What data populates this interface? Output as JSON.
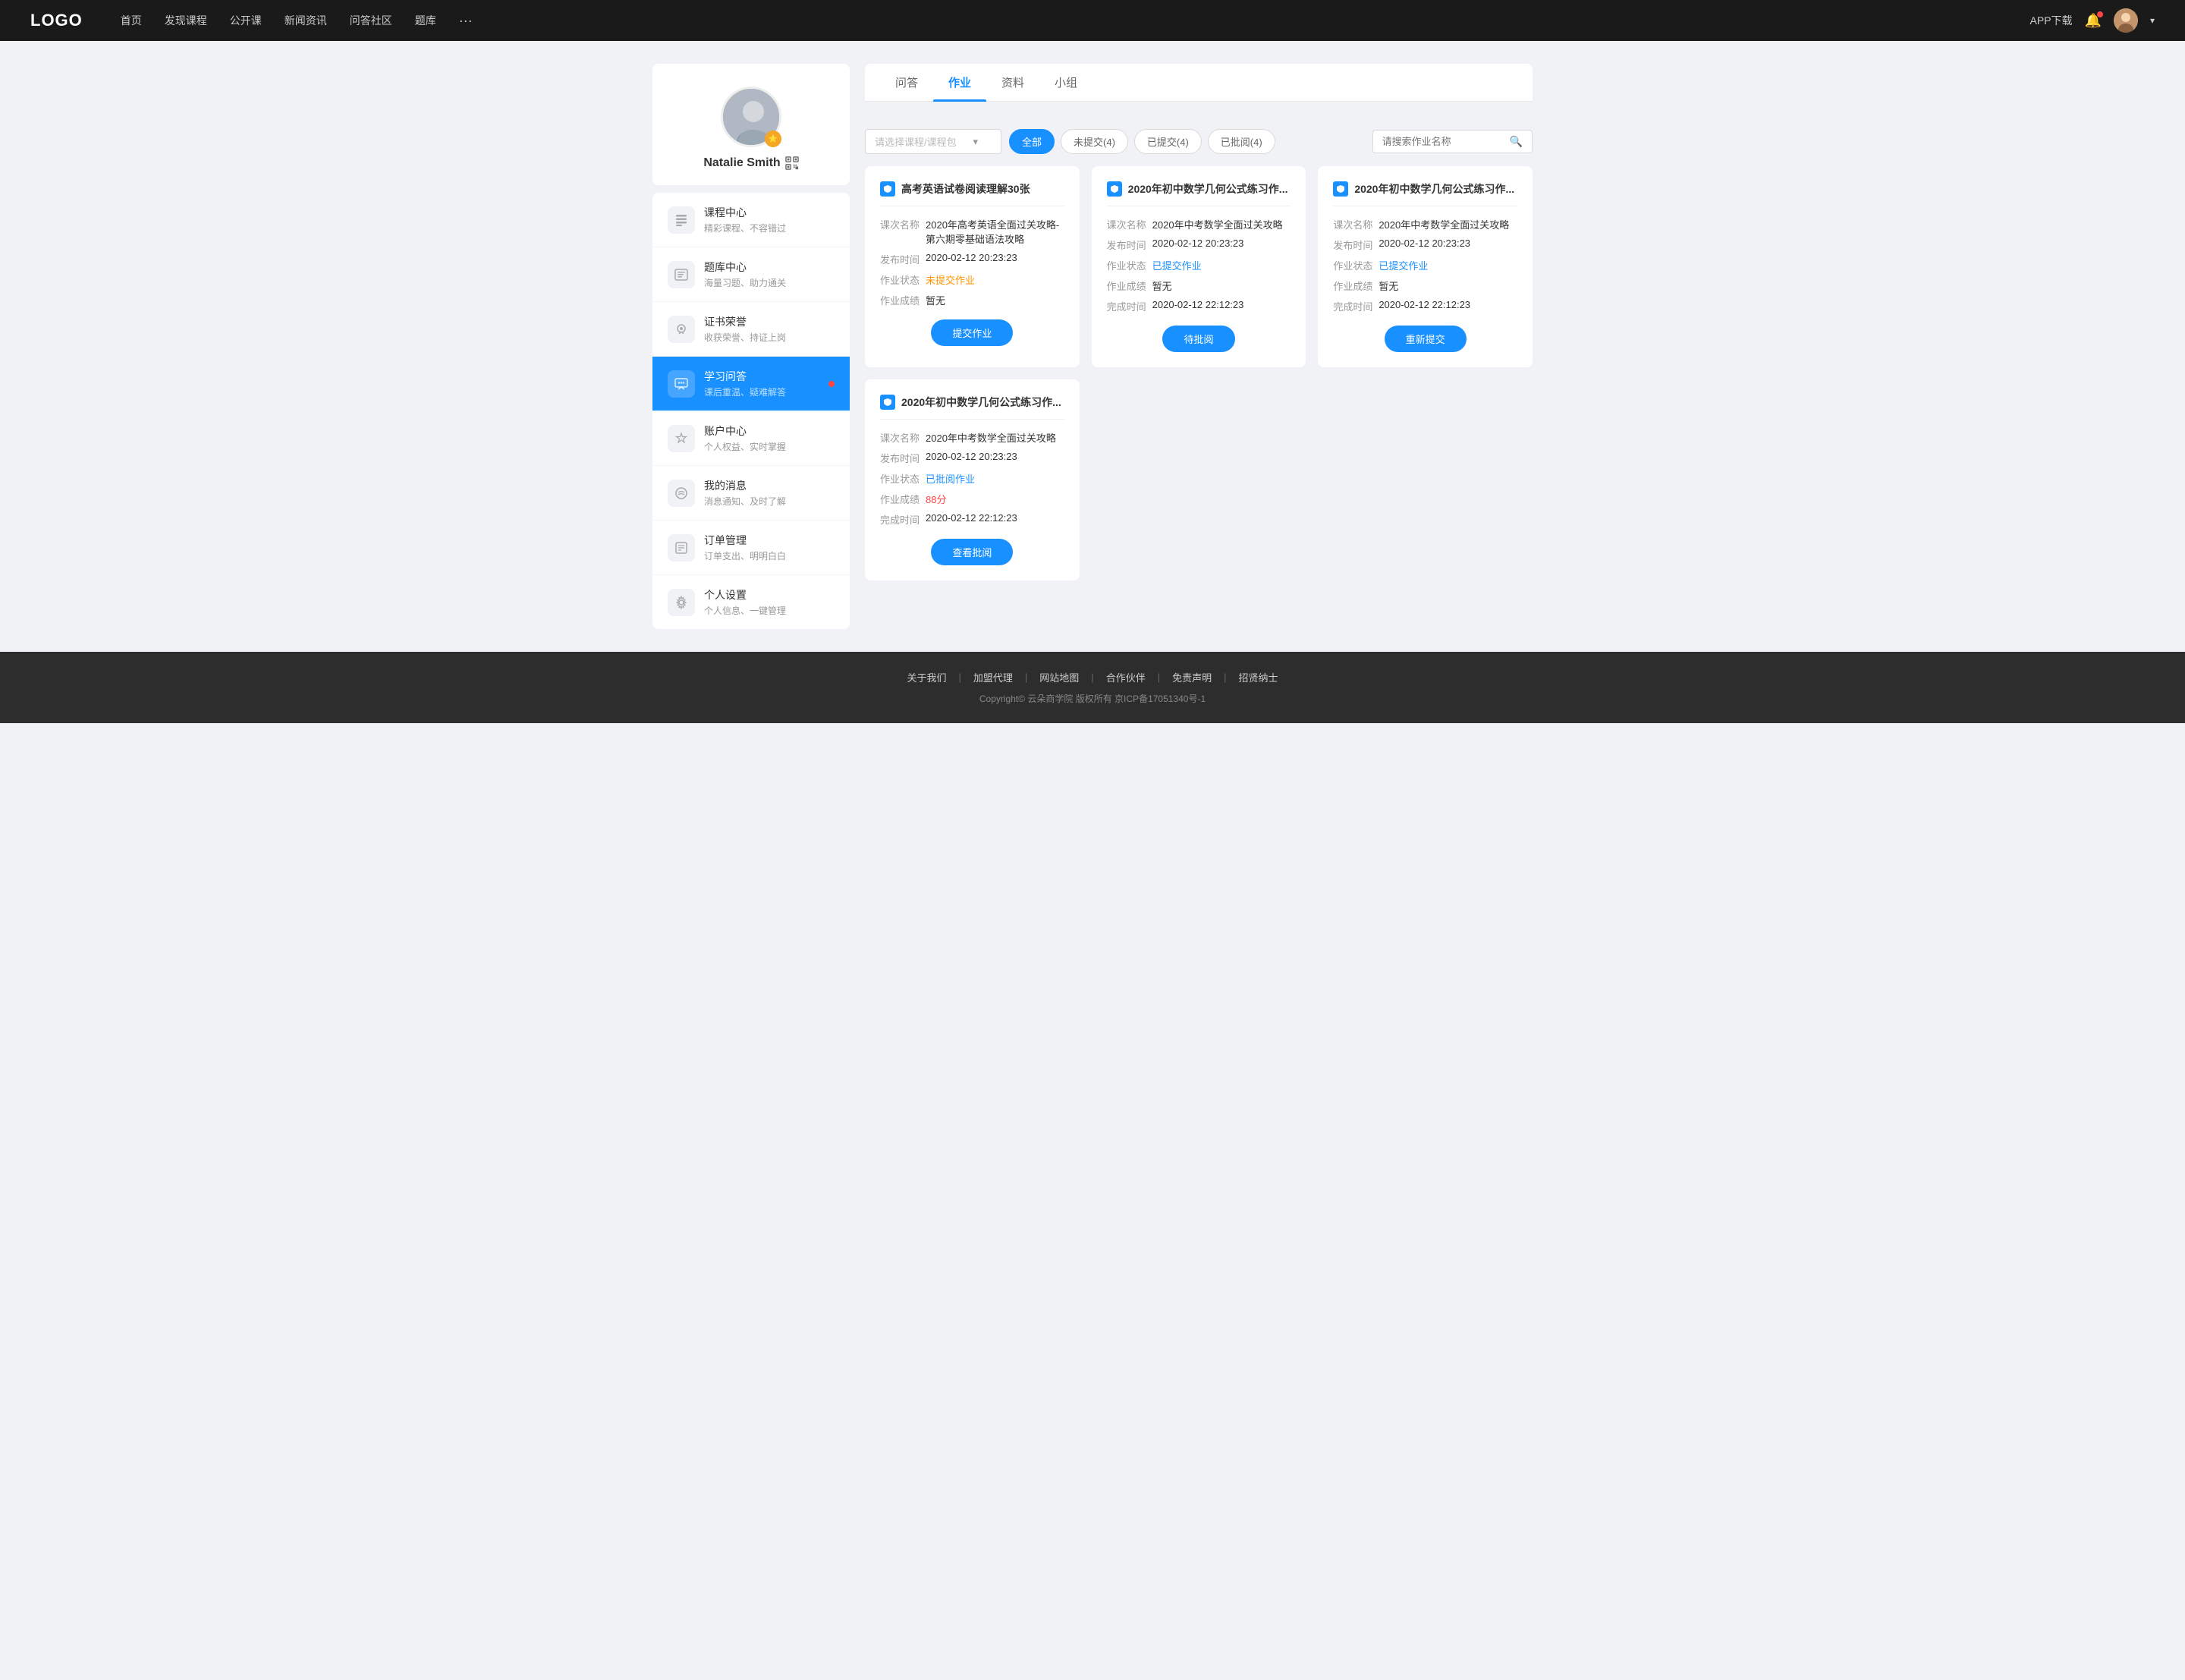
{
  "nav": {
    "logo": "LOGO",
    "items": [
      "首页",
      "发现课程",
      "公开课",
      "新闻资讯",
      "问答社区",
      "题库"
    ],
    "more": "···",
    "download": "APP下载"
  },
  "sidebar": {
    "profile": {
      "name": "Natalie Smith"
    },
    "menu": [
      {
        "id": "course-center",
        "icon": "📋",
        "title": "课程中心",
        "subtitle": "精彩课程、不容错过",
        "active": false
      },
      {
        "id": "question-bank",
        "icon": "📝",
        "title": "题库中心",
        "subtitle": "海量习题、助力通关",
        "active": false
      },
      {
        "id": "certificate",
        "icon": "🏆",
        "title": "证书荣誉",
        "subtitle": "收获荣誉、持证上岗",
        "active": false
      },
      {
        "id": "study-qa",
        "icon": "💬",
        "title": "学习问答",
        "subtitle": "课后重温、疑难解答",
        "active": true,
        "dot": true
      },
      {
        "id": "account",
        "icon": "💎",
        "title": "账户中心",
        "subtitle": "个人权益、实时掌握",
        "active": false
      },
      {
        "id": "messages",
        "icon": "💬",
        "title": "我的消息",
        "subtitle": "消息通知、及时了解",
        "active": false
      },
      {
        "id": "orders",
        "icon": "📄",
        "title": "订单管理",
        "subtitle": "订单支出、明明白白",
        "active": false
      },
      {
        "id": "settings",
        "icon": "⚙️",
        "title": "个人设置",
        "subtitle": "个人信息、一键管理",
        "active": false
      }
    ]
  },
  "content": {
    "tabs": [
      "问答",
      "作业",
      "资料",
      "小组"
    ],
    "active_tab": "作业",
    "filter_placeholder": "请选择课程/课程包",
    "search_placeholder": "请搜索作业名称",
    "filter_buttons": [
      {
        "label": "全部",
        "active": true
      },
      {
        "label": "未提交(4)",
        "active": false
      },
      {
        "label": "已提交(4)",
        "active": false
      },
      {
        "label": "已批阅(4)",
        "active": false
      }
    ],
    "cards": [
      {
        "id": "card1",
        "title": "高考英语试卷阅读理解30张",
        "rows": [
          {
            "label": "课次名称",
            "value": "2020年高考英语全面过关攻略-第六期零基础语法攻略",
            "type": "normal"
          },
          {
            "label": "发布时间",
            "value": "2020-02-12 20:23:23",
            "type": "normal"
          },
          {
            "label": "作业状态",
            "value": "未提交作业",
            "type": "pending"
          },
          {
            "label": "作业成绩",
            "value": "暂无",
            "type": "normal"
          }
        ],
        "button": {
          "label": "提交作业",
          "type": "primary"
        }
      },
      {
        "id": "card2",
        "title": "2020年初中数学几何公式练习作...",
        "rows": [
          {
            "label": "课次名称",
            "value": "2020年中考数学全面过关攻略",
            "type": "normal"
          },
          {
            "label": "发布时间",
            "value": "2020-02-12 20:23:23",
            "type": "normal"
          },
          {
            "label": "作业状态",
            "value": "已提交作业",
            "type": "submitted"
          },
          {
            "label": "作业成绩",
            "value": "暂无",
            "type": "normal"
          },
          {
            "label": "完成时间",
            "value": "2020-02-12 22:12:23",
            "type": "normal"
          }
        ],
        "button": {
          "label": "待批阅",
          "type": "primary"
        }
      },
      {
        "id": "card3",
        "title": "2020年初中数学几何公式练习作...",
        "rows": [
          {
            "label": "课次名称",
            "value": "2020年中考数学全面过关攻略",
            "type": "normal"
          },
          {
            "label": "发布时间",
            "value": "2020-02-12 20:23:23",
            "type": "normal"
          },
          {
            "label": "作业状态",
            "value": "已提交作业",
            "type": "submitted"
          },
          {
            "label": "作业成绩",
            "value": "暂无",
            "type": "normal"
          },
          {
            "label": "完成时间",
            "value": "2020-02-12 22:12:23",
            "type": "normal"
          }
        ],
        "button": {
          "label": "重新提交",
          "type": "primary"
        }
      },
      {
        "id": "card4",
        "title": "2020年初中数学几何公式练习作...",
        "rows": [
          {
            "label": "课次名称",
            "value": "2020年中考数学全面过关攻略",
            "type": "normal"
          },
          {
            "label": "发布时间",
            "value": "2020-02-12 20:23:23",
            "type": "normal"
          },
          {
            "label": "作业状态",
            "value": "已批阅作业",
            "type": "reviewed"
          },
          {
            "label": "作业成绩",
            "value": "88分",
            "type": "score"
          },
          {
            "label": "完成时间",
            "value": "2020-02-12 22:12:23",
            "type": "normal"
          }
        ],
        "button": {
          "label": "查看批阅",
          "type": "primary"
        }
      }
    ]
  },
  "footer": {
    "links": [
      "关于我们",
      "加盟代理",
      "网站地图",
      "合作伙伴",
      "免责声明",
      "招贤纳士"
    ],
    "copyright": "Copyright© 云朵商学院  版权所有    京ICP备17051340号-1"
  }
}
